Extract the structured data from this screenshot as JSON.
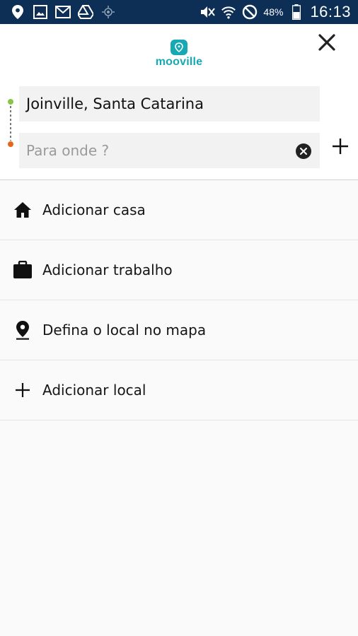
{
  "status_bar": {
    "battery_percent": "48%",
    "time": "16:13",
    "icons": [
      "location-icon",
      "gallery-icon",
      "gmail-icon",
      "drive-icon",
      "gps-icon",
      "mute-icon",
      "wifi-icon",
      "blocked-icon",
      "battery-icon"
    ]
  },
  "header": {
    "logo_text": "mooville",
    "brand_color": "#17a9b3",
    "close_icon": "close-icon"
  },
  "route": {
    "origin_value": "Joinville, Santa Catarina",
    "destination_placeholder": "Para onde ?",
    "destination_value": "",
    "origin_dot_color": "#8bc34a",
    "destination_dot_color": "#e8661c"
  },
  "list": {
    "items": [
      {
        "label": "Adicionar casa",
        "icon": "home-icon"
      },
      {
        "label": "Adicionar trabalho",
        "icon": "briefcase-icon"
      },
      {
        "label": "Defina o local no mapa",
        "icon": "map-pin-icon"
      },
      {
        "label": "Adicionar local",
        "icon": "plus-icon"
      }
    ]
  }
}
